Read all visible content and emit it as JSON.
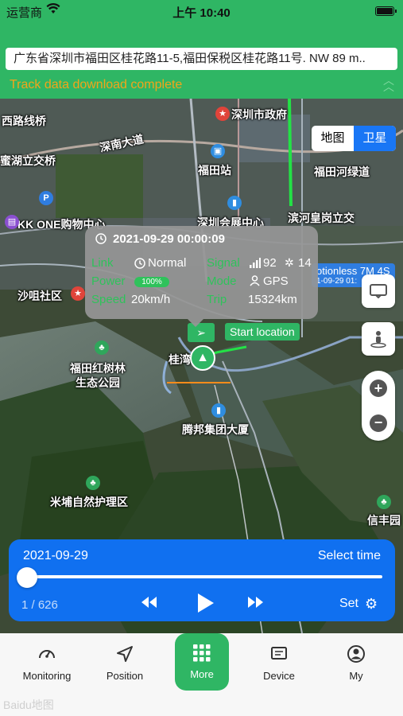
{
  "status_bar": {
    "carrier": "运营商",
    "time": "上午 10:40"
  },
  "header": {
    "address": "广东省深圳市福田区桂花路11-5,福田保税区桂花路11号. NW 89 m..",
    "download_status": "Track data download complete",
    "collapse_icon": "double-chevron-up-icon"
  },
  "map_type": {
    "options": [
      "地图",
      "卫星"
    ],
    "selected": "卫星"
  },
  "map_labels": {
    "xiyuan": "西路线桥",
    "shennan": "深南大道",
    "futian_station": "福田站",
    "gov": "深圳市政府",
    "lake": "蜜湖立交桥",
    "kkone": "KK ONE购物中心",
    "futian_river": "福田河绿道",
    "expo": "深圳会展中心",
    "binhe": "滨河皇岗立交",
    "shazui": "沙咀社区",
    "mangrove": "福田红树林\n生态公园",
    "tencent": "腾邦集团大厦",
    "mipu": "米埔自然护理区",
    "guiwan": "桂湾",
    "xinfeng": "信丰园"
  },
  "info_card": {
    "time": "2021-09-29 00:00:09",
    "link_label": "Link",
    "link_value": "Normal",
    "power_label": "Power",
    "power_value": "100%",
    "speed_label": "Speed",
    "speed_value": "20km/h",
    "signal_label": "Signal",
    "signal_value": "92",
    "satellite_value": "14",
    "mode_label": "Mode",
    "mode_value": "GPS",
    "trip_label": "Trip",
    "trip_value": "15324km"
  },
  "start_location": "Start location",
  "motionless": {
    "line1": "otionless 7M 4S",
    "line2": "1-09-29 01:"
  },
  "playback": {
    "date": "2021-09-29",
    "select_time": "Select time",
    "count": "1 / 626",
    "set_label": "Set",
    "progress": 0.0016
  },
  "nav": {
    "items": [
      {
        "label": "Monitoring",
        "icon": "speedometer-icon"
      },
      {
        "label": "Position",
        "icon": "navigation-arrow-icon"
      },
      {
        "label": "More",
        "icon": "grid-icon"
      },
      {
        "label": "Device",
        "icon": "device-screen-icon"
      },
      {
        "label": "My",
        "icon": "user-icon"
      }
    ]
  },
  "watermark": "Baidu地图",
  "colors": {
    "brand_green": "#2fb664",
    "accent_blue": "#1070f0",
    "warning": "#f2a51a"
  }
}
